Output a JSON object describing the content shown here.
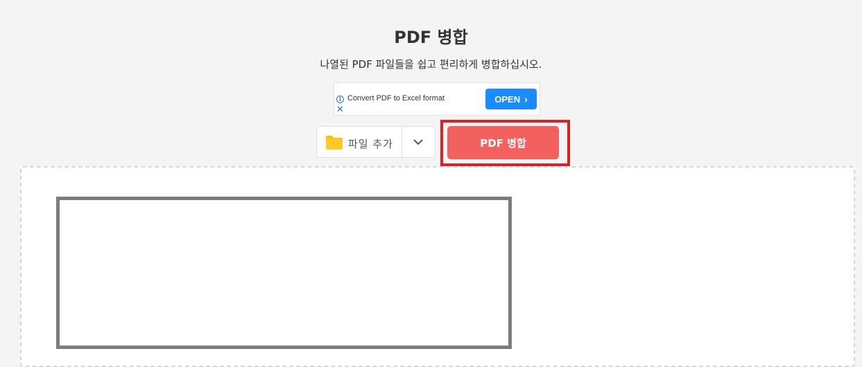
{
  "header": {
    "title": "PDF 병합",
    "subtitle": "나열된 PDF 파일들을 쉽고 편리하게 병합하십시오."
  },
  "ad": {
    "text": "Convert PDF to Excel format",
    "cta": "OPEN",
    "info_icon": "info-icon",
    "close_icon": "close-icon"
  },
  "toolbar": {
    "add_files_label": "파일 추가",
    "add_files_icon": "folder-icon",
    "dropdown_icon": "chevron-down-icon",
    "merge_label": "PDF 병합"
  },
  "colors": {
    "page_background": "#f4f4f4",
    "accent": "#f26060",
    "highlight": "#e02020",
    "ad_button": "#1a8cff",
    "folder": "#ffc107"
  }
}
